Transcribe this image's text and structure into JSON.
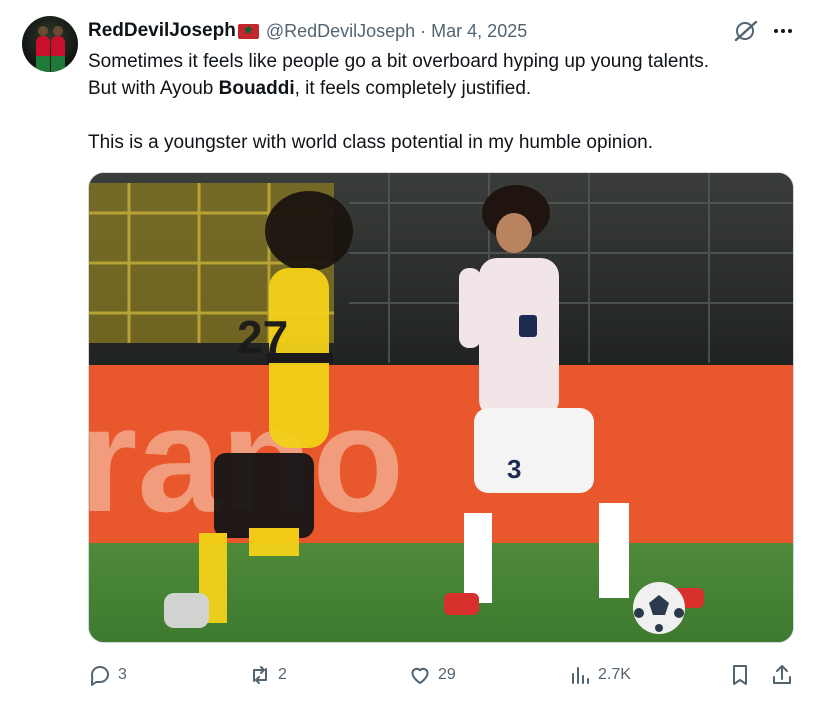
{
  "author": {
    "display_name": "RedDevilJoseph",
    "flag": "morocco-flag",
    "handle": "@RedDevilJoseph",
    "separator": "·",
    "date": "Mar 4, 2025"
  },
  "post": {
    "line1": "Sometimes it feels like people go a bit overboard hyping up young talents.",
    "line2_before": "But with Ayoub ",
    "line2_bold": "Bouaddi",
    "line2_after": ", it feels completely justified.",
    "line3": "This is a youngster with world class potential in my humble opinion."
  },
  "media": {
    "description_icon": "photo",
    "dortmund_number": "27",
    "lille_number": "3"
  },
  "actions": {
    "replies": "3",
    "reposts": "2",
    "likes": "29",
    "views": "2.7K"
  },
  "icons": {
    "grok": "grok-icon",
    "more": "more-icon",
    "reply": "reply-icon",
    "repost": "repost-icon",
    "like": "heart-icon",
    "views": "views-icon",
    "bookmark": "bookmark-icon",
    "share": "share-icon"
  },
  "colors": {
    "text_primary": "#0f1419",
    "text_secondary": "#536471",
    "border": "#cfd9de"
  }
}
